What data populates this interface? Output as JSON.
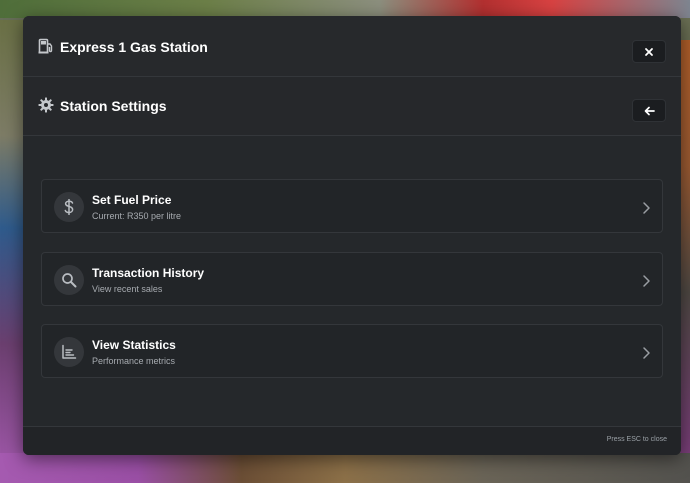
{
  "window": {
    "title": "Express 1 Gas Station",
    "title_icon": "fuel-pump-icon",
    "close_icon": "close-icon"
  },
  "section": {
    "title": "Station Settings",
    "title_icon": "gear-icon",
    "back_icon": "arrow-left-icon"
  },
  "menu": {
    "items": [
      {
        "title": "Set Fuel Price",
        "subtitle": "Current: R350 per litre",
        "icon": "dollar-icon"
      },
      {
        "title": "Transaction History",
        "subtitle": "View recent sales",
        "icon": "search-icon"
      },
      {
        "title": "View Statistics",
        "subtitle": "Performance metrics",
        "icon": "chart-icon"
      }
    ],
    "chevron_icon": "chevron-right-icon"
  },
  "footer": {
    "hint": "Press ESC to close"
  },
  "colors": {
    "panel_bg": "#25282b",
    "item_bg": "#222528",
    "icon_circle": "#34373b",
    "border": "#34373b",
    "text_primary": "#ffffff",
    "text_secondary": "#a7abb0"
  }
}
